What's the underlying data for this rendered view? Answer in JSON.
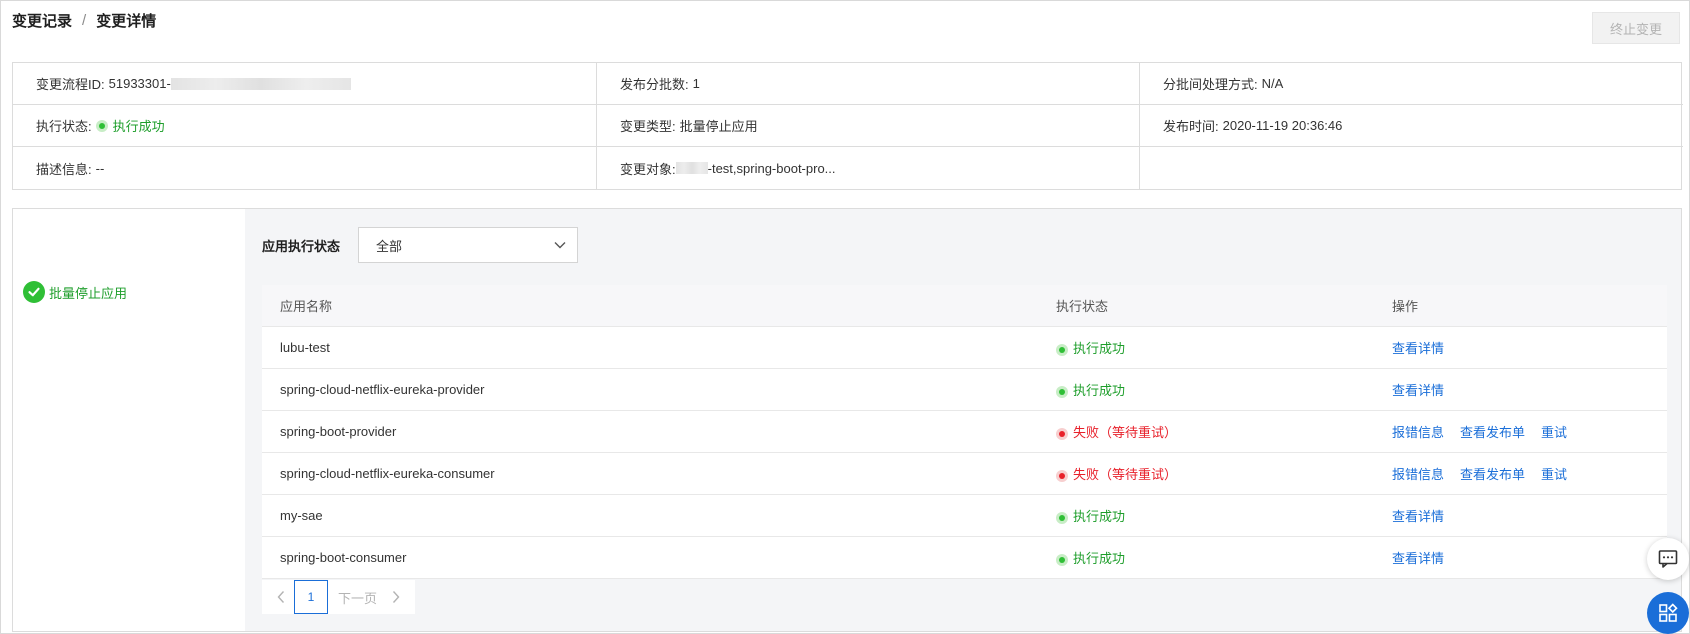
{
  "breadcrumb": {
    "parent": "变更记录",
    "separator": "/",
    "current": "变更详情"
  },
  "toolbar": {
    "stop_label": "终止变更"
  },
  "info": {
    "flow_id_label": "变更流程ID:",
    "flow_id_value": "51933301-",
    "batch_count_label": "发布分批数:",
    "batch_count_value": "1",
    "batch_mode_label": "分批间处理方式:",
    "batch_mode_value": "N/A",
    "exec_status_label": "执行状态:",
    "exec_status_value": "执行成功",
    "change_type_label": "变更类型:",
    "change_type_value": "批量停止应用",
    "publish_time_label": "发布时间:",
    "publish_time_value": "2020-11-19 20:36:46",
    "desc_label": "描述信息:",
    "desc_value": "--",
    "target_label": "变更对象:",
    "target_value": "-test,spring-boot-pro..."
  },
  "stage": {
    "label": "批量停止应用",
    "icon": "check-circle-icon"
  },
  "filter": {
    "label": "应用执行状态",
    "selected": "全部"
  },
  "table": {
    "headers": {
      "name": "应用名称",
      "status": "执行状态",
      "ops": "操作"
    },
    "rows": [
      {
        "name": "lubu-test",
        "status": "执行成功",
        "state": "success",
        "ops": [
          "查看详情"
        ]
      },
      {
        "name": "spring-cloud-netflix-eureka-provider",
        "status": "执行成功",
        "state": "success",
        "ops": [
          "查看详情"
        ]
      },
      {
        "name": "spring-boot-provider",
        "status": "失败（等待重试）",
        "state": "fail",
        "ops": [
          "报错信息",
          "查看发布单",
          "重试"
        ]
      },
      {
        "name": "spring-cloud-netflix-eureka-consumer",
        "status": "失败（等待重试）",
        "state": "fail",
        "ops": [
          "报错信息",
          "查看发布单",
          "重试"
        ]
      },
      {
        "name": "my-sae",
        "status": "执行成功",
        "state": "success",
        "ops": [
          "查看详情"
        ]
      },
      {
        "name": "spring-boot-consumer",
        "status": "执行成功",
        "state": "success",
        "ops": [
          "查看详情"
        ]
      }
    ]
  },
  "pager": {
    "current": "1",
    "next_label": "下一页"
  },
  "colors": {
    "success": "#2fbf36",
    "fail": "#e8212b",
    "link": "#1a6ed8"
  }
}
